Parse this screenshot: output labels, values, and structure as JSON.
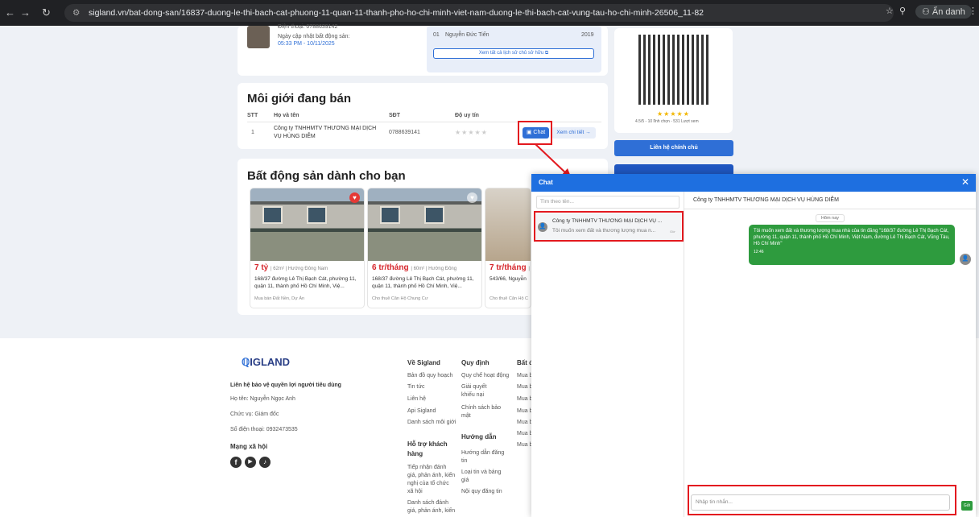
{
  "browser": {
    "url": "sigland.vn/bat-dong-san/16837-duong-le-thi-bach-cat-phuong-11-quan-11-thanh-pho-ho-chi-minh-viet-nam-duong-le-thi-bach-cat-vung-tau-ho-chi-minh-26506_11-82",
    "incognito": "Ẩn danh"
  },
  "owner": {
    "phone": "Điện thoại: 0788639142",
    "updated_label": "Ngày cập nhật bất động sản:",
    "updated_value": "05:33 PM - 10/11/2025",
    "history_row": {
      "index": "01",
      "name": "Nguyễn Đức Tiến",
      "year": "2019"
    },
    "history_button": "Xem tất cả lịch sử chủ sở hữu"
  },
  "rating": {
    "stars": "★★★★★",
    "text": "4.5/5 - 10 lĩnh chọn - 531 Lượt xem"
  },
  "contact_button": "Liên hệ chính chủ",
  "brokers": {
    "title": "Môi giới đang bán",
    "headers": [
      "STT",
      "Họ và tên",
      "SĐT",
      "Độ uy tín"
    ],
    "row": {
      "stt": "1",
      "name": "Công ty TNHHMTV THƯƠNG MẠI DỊCH VỤ HÙNG DIỄM",
      "phone": "0788639141",
      "stars": "★★★★★",
      "chat": "Chat",
      "detail": "Xem chi tiết →"
    }
  },
  "recommend": {
    "title": "Bất động sản dành cho bạn",
    "items": [
      {
        "price": "7 tỷ",
        "meta": "| 62m² | Hướng Đông Nam",
        "addr": "168/37 đường Lê Thị Bạch Cát, phường 11, quận 11, thành phố Hồ Chí Minh, Việ...",
        "cat": "Mua bán Đất Nền, Dự Án"
      },
      {
        "price": "6 tr/tháng",
        "meta": "| 60m² | Hướng Đông",
        "addr": "168/37 đường Lê Thị Bạch Cát, phường 11, quận 11, thành phố Hồ Chí Minh, Việ...",
        "cat": "Cho thuê Căn Hộ Chung Cư"
      },
      {
        "price": "7 tr/tháng",
        "meta": "| 6",
        "addr": "543/66, Nguyễn",
        "cat": "Cho thuê Căn Hộ C"
      }
    ]
  },
  "footer": {
    "brand": "IGLAND",
    "consumer_title": "Liên hệ bảo vệ quyền lợi người tiêu dùng",
    "name": "Họ tên: Nguyễn Ngọc Anh",
    "position": "Chức vụ: Giám đốc",
    "phone": "Số điện thoại: 0932473535",
    "social": "Mạng xã hội",
    "about_title": "Về Sigland",
    "about": [
      "Bản đồ quy hoạch",
      "Tin tức",
      "Liên hệ",
      "Api Sigland",
      "Danh sách môi giới"
    ],
    "support_title": "Hỗ trợ khách hàng",
    "support": [
      "Tiếp nhận đánh giá, phản ánh, kiến nghị của tổ chức xã hội",
      "Danh sách đánh giá, phản ánh, kiến"
    ],
    "rules_title": "Quy định",
    "rules": [
      "Quy chế hoạt động",
      "Giải quyết khiếu nại",
      "Chính sách bảo mật"
    ],
    "guide_title": "Hướng dẫn",
    "guide": [
      "Hướng dẫn đăng tin",
      "Loại tin và bảng giá",
      "Nội quy đăng tin"
    ],
    "bds_title": "Bất đ",
    "bds": [
      "Mua b",
      "Mua b",
      "Mua b",
      "Mua b",
      "Mua b",
      "Mua b",
      "Mua b"
    ]
  },
  "chat": {
    "title": "Chat",
    "search_placeholder": "Tìm theo tên...",
    "contact_name": "Công ty TNHHMTV THƯƠNG MẠI DỊCH VỤ ...",
    "contact_preview": "Tôi muốn xem đất và thương lượng mua n...",
    "contact_time": "Giờ",
    "header_name": "Công ty TNHHMTV THƯƠNG MẠI DỊCH VỤ HÙNG DIỄM",
    "date_chip": "Hôm nay",
    "message": "Tôi muốn xem đất và thương lượng mua nhà của tin đăng \"168/37 đường Lê Thị Bạch Cát, phường 11, quận 11, thành phố Hồ Chí Minh, Việt Nam, đường Lê Thị Bạch Cát, Vũng Tàu, Hồ Chí Minh\"",
    "msg_time": "12:46",
    "input_placeholder": "Nhập tin nhắn...",
    "send": "Gửi"
  }
}
